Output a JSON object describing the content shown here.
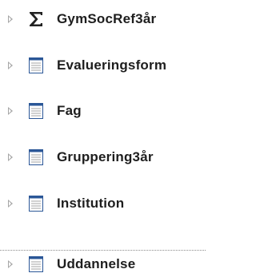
{
  "tree": {
    "items": [
      {
        "label": "GymSocRef3år",
        "icon": "sigma-icon",
        "focused": false
      },
      {
        "label": "Evalueringsform",
        "icon": "table-icon",
        "focused": false
      },
      {
        "label": "Fag",
        "icon": "table-icon",
        "focused": false
      },
      {
        "label": "Gruppering3år",
        "icon": "table-icon",
        "focused": false
      },
      {
        "label": "Institution",
        "icon": "table-icon",
        "focused": false
      },
      {
        "label": "Uddannelse",
        "icon": "table-icon",
        "focused": true
      }
    ]
  },
  "colors": {
    "text": "#1e1e1e",
    "icon_blue": "#2b5797",
    "icon_grey": "#bdbdbd",
    "expander": "#a6a6a6"
  }
}
